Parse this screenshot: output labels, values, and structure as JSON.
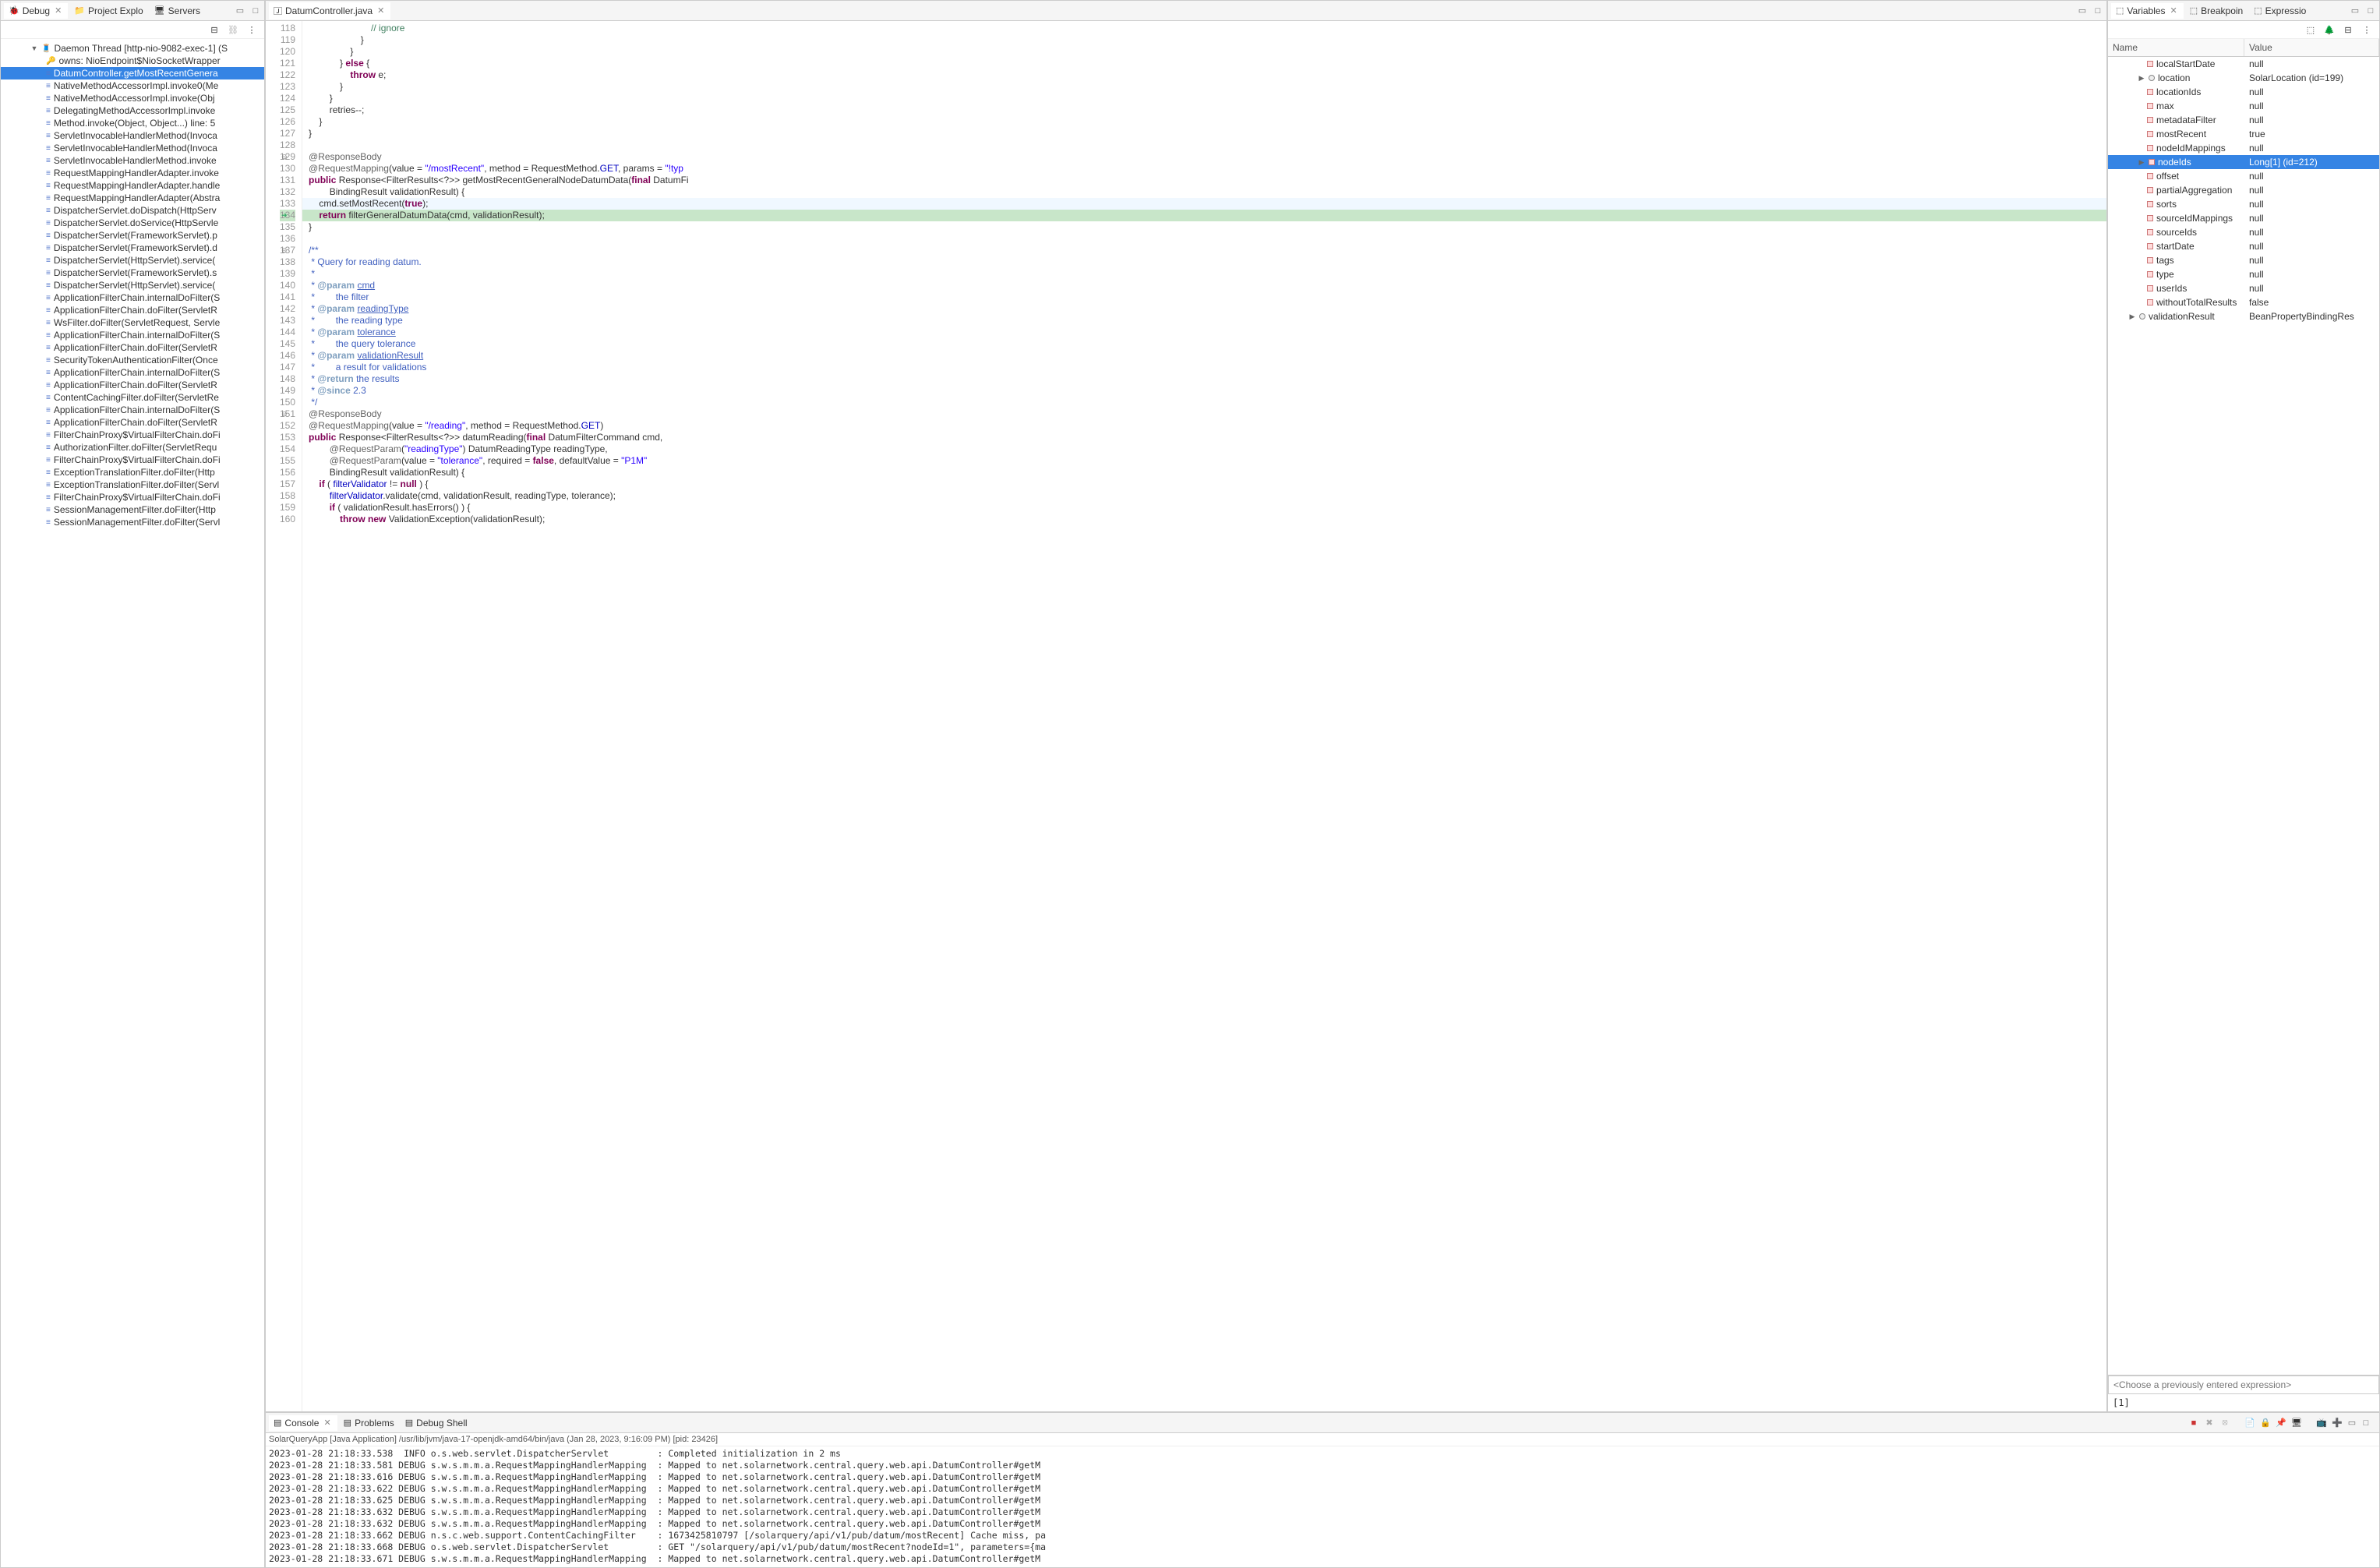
{
  "leftPanel": {
    "tabs": [
      {
        "label": "Debug",
        "icon": "🐞",
        "active": true,
        "close": true
      },
      {
        "label": "Project Explo",
        "icon": "📁"
      },
      {
        "label": "Servers",
        "icon": "🖥"
      }
    ],
    "tree": [
      {
        "indent": 30,
        "chevron": "▼",
        "icon": "🧵",
        "text": "Daemon Thread [http-nio-9082-exec-1] (S"
      },
      {
        "indent": 50,
        "icon": "🔑",
        "text": "owns: NioEndpoint$NioSocketWrapper"
      },
      {
        "indent": 50,
        "icon": "≡",
        "text": "DatumController.getMostRecentGenera",
        "selected": true
      },
      {
        "indent": 50,
        "icon": "≡",
        "text": "NativeMethodAccessorImpl.invoke0(Me"
      },
      {
        "indent": 50,
        "icon": "≡",
        "text": "NativeMethodAccessorImpl.invoke(Obj"
      },
      {
        "indent": 50,
        "icon": "≡",
        "text": "DelegatingMethodAccessorImpl.invoke"
      },
      {
        "indent": 50,
        "icon": "≡",
        "text": "Method.invoke(Object, Object...) line: 5"
      },
      {
        "indent": 50,
        "icon": "≡",
        "text": "ServletInvocableHandlerMethod(Invoca"
      },
      {
        "indent": 50,
        "icon": "≡",
        "text": "ServletInvocableHandlerMethod(Invoca"
      },
      {
        "indent": 50,
        "icon": "≡",
        "text": "ServletInvocableHandlerMethod.invoke"
      },
      {
        "indent": 50,
        "icon": "≡",
        "text": "RequestMappingHandlerAdapter.invoke"
      },
      {
        "indent": 50,
        "icon": "≡",
        "text": "RequestMappingHandlerAdapter.handle"
      },
      {
        "indent": 50,
        "icon": "≡",
        "text": "RequestMappingHandlerAdapter(Abstra"
      },
      {
        "indent": 50,
        "icon": "≡",
        "text": "DispatcherServlet.doDispatch(HttpServ"
      },
      {
        "indent": 50,
        "icon": "≡",
        "text": "DispatcherServlet.doService(HttpServle"
      },
      {
        "indent": 50,
        "icon": "≡",
        "text": "DispatcherServlet(FrameworkServlet).p"
      },
      {
        "indent": 50,
        "icon": "≡",
        "text": "DispatcherServlet(FrameworkServlet).d"
      },
      {
        "indent": 50,
        "icon": "≡",
        "text": "DispatcherServlet(HttpServlet).service("
      },
      {
        "indent": 50,
        "icon": "≡",
        "text": "DispatcherServlet(FrameworkServlet).s"
      },
      {
        "indent": 50,
        "icon": "≡",
        "text": "DispatcherServlet(HttpServlet).service("
      },
      {
        "indent": 50,
        "icon": "≡",
        "text": "ApplicationFilterChain.internalDoFilter(S"
      },
      {
        "indent": 50,
        "icon": "≡",
        "text": "ApplicationFilterChain.doFilter(ServletR"
      },
      {
        "indent": 50,
        "icon": "≡",
        "text": "WsFilter.doFilter(ServletRequest, Servle"
      },
      {
        "indent": 50,
        "icon": "≡",
        "text": "ApplicationFilterChain.internalDoFilter(S"
      },
      {
        "indent": 50,
        "icon": "≡",
        "text": "ApplicationFilterChain.doFilter(ServletR"
      },
      {
        "indent": 50,
        "icon": "≡",
        "text": "SecurityTokenAuthenticationFilter(Once"
      },
      {
        "indent": 50,
        "icon": "≡",
        "text": "ApplicationFilterChain.internalDoFilter(S"
      },
      {
        "indent": 50,
        "icon": "≡",
        "text": "ApplicationFilterChain.doFilter(ServletR"
      },
      {
        "indent": 50,
        "icon": "≡",
        "text": "ContentCachingFilter.doFilter(ServletRe"
      },
      {
        "indent": 50,
        "icon": "≡",
        "text": "ApplicationFilterChain.internalDoFilter(S"
      },
      {
        "indent": 50,
        "icon": "≡",
        "text": "ApplicationFilterChain.doFilter(ServletR"
      },
      {
        "indent": 50,
        "icon": "≡",
        "text": "FilterChainProxy$VirtualFilterChain.doFi"
      },
      {
        "indent": 50,
        "icon": "≡",
        "text": "AuthorizationFilter.doFilter(ServletRequ"
      },
      {
        "indent": 50,
        "icon": "≡",
        "text": "FilterChainProxy$VirtualFilterChain.doFi"
      },
      {
        "indent": 50,
        "icon": "≡",
        "text": "ExceptionTranslationFilter.doFilter(Http"
      },
      {
        "indent": 50,
        "icon": "≡",
        "text": "ExceptionTranslationFilter.doFilter(Servl"
      },
      {
        "indent": 50,
        "icon": "≡",
        "text": "FilterChainProxy$VirtualFilterChain.doFi"
      },
      {
        "indent": 50,
        "icon": "≡",
        "text": "SessionManagementFilter.doFilter(Http"
      },
      {
        "indent": 50,
        "icon": "≡",
        "text": "SessionManagementFilter.doFilter(Servl"
      }
    ]
  },
  "editor": {
    "tab": "DatumController.java",
    "startLine": 118,
    "lines": [
      {
        "n": 118,
        "html": "                        <span class='cm'>// ignore</span>"
      },
      {
        "n": 119,
        "html": "                    }"
      },
      {
        "n": 120,
        "html": "                }"
      },
      {
        "n": 121,
        "html": "            } <span class='kw'>else</span> {"
      },
      {
        "n": 122,
        "html": "                <span class='kw'>throw</span> e;"
      },
      {
        "n": 123,
        "html": "            }"
      },
      {
        "n": 124,
        "html": "        }"
      },
      {
        "n": 125,
        "html": "        retries--;"
      },
      {
        "n": 126,
        "html": "    }"
      },
      {
        "n": 127,
        "html": "}"
      },
      {
        "n": 128,
        "html": ""
      },
      {
        "n": 129,
        "fold": "⊖",
        "html": "<span class='ann'>@ResponseBody</span>"
      },
      {
        "n": 130,
        "html": "<span class='ann'>@RequestMapping</span>(value = <span class='str'>\"/mostRecent\"</span>, method = RequestMethod.<span class='fld'>GET</span>, params = <span class='str'>\"!typ</span>"
      },
      {
        "n": 131,
        "html": "<span class='kw'>public</span> Response&lt;FilterResults&lt;?&gt;&gt; getMostRecentGeneralNodeDatumData(<span class='kw'>final</span> DatumFi"
      },
      {
        "n": 132,
        "html": "        BindingResult validationResult) {"
      },
      {
        "n": 133,
        "execbg": true,
        "html": "    cmd.setMostRecent(<span class='kw'>true</span>);"
      },
      {
        "n": 134,
        "current": true,
        "html": "    <span class='kw'>return</span> filterGeneralDatumData(cmd, validationResult);"
      },
      {
        "n": 135,
        "html": "}"
      },
      {
        "n": 136,
        "html": ""
      },
      {
        "n": 137,
        "fold": "⊖",
        "html": "<span class='jdoc'>/**</span>"
      },
      {
        "n": 138,
        "html": "<span class='jdoc'> * Query for reading datum.</span>"
      },
      {
        "n": 139,
        "html": "<span class='jdoc'> *</span>"
      },
      {
        "n": 140,
        "html": "<span class='jdoc'> * <span class='jdoc-tag'>@param</span> <span class='jdoc-link'>cmd</span></span>"
      },
      {
        "n": 141,
        "html": "<span class='jdoc'> *        the filter</span>"
      },
      {
        "n": 142,
        "html": "<span class='jdoc'> * <span class='jdoc-tag'>@param</span> <span class='jdoc-link'>readingType</span></span>"
      },
      {
        "n": 143,
        "html": "<span class='jdoc'> *        the reading type</span>"
      },
      {
        "n": 144,
        "html": "<span class='jdoc'> * <span class='jdoc-tag'>@param</span> <span class='jdoc-link'>tolerance</span></span>"
      },
      {
        "n": 145,
        "html": "<span class='jdoc'> *        the query tolerance</span>"
      },
      {
        "n": 146,
        "html": "<span class='jdoc'> * <span class='jdoc-tag'>@param</span> <span class='jdoc-link'>validationResult</span></span>"
      },
      {
        "n": 147,
        "html": "<span class='jdoc'> *        a result for validations</span>"
      },
      {
        "n": 148,
        "html": "<span class='jdoc'> * <span class='jdoc-tag'>@return</span> the results</span>"
      },
      {
        "n": 149,
        "html": "<span class='jdoc'> * <span class='jdoc-tag'>@since</span> 2.3</span>"
      },
      {
        "n": 150,
        "html": "<span class='jdoc'> */</span>"
      },
      {
        "n": 151,
        "fold": "⊖",
        "html": "<span class='ann'>@ResponseBody</span>"
      },
      {
        "n": 152,
        "html": "<span class='ann'>@RequestMapping</span>(value = <span class='str'>\"/reading\"</span>, method = RequestMethod.<span class='fld'>GET</span>)"
      },
      {
        "n": 153,
        "html": "<span class='kw'>public</span> Response&lt;FilterResults&lt;?&gt;&gt; datumReading(<span class='kw'>final</span> DatumFilterCommand cmd,"
      },
      {
        "n": 154,
        "html": "        <span class='ann'>@RequestParam</span>(<span class='str'>\"readingType\"</span>) DatumReadingType readingType,"
      },
      {
        "n": 155,
        "html": "        <span class='ann'>@RequestParam</span>(value = <span class='str'>\"tolerance\"</span>, required = <span class='kw'>false</span>, defaultValue = <span class='str'>\"P1M\"</span>"
      },
      {
        "n": 156,
        "html": "        BindingResult validationResult) {"
      },
      {
        "n": 157,
        "html": "    <span class='kw'>if</span> ( <span class='fld'>filterValidator</span> != <span class='kw'>null</span> ) {"
      },
      {
        "n": 158,
        "html": "        <span class='fld'>filterValidator</span>.validate(cmd, validationResult, readingType, tolerance);"
      },
      {
        "n": 159,
        "html": "        <span class='kw'>if</span> ( validationResult.hasErrors() ) {"
      },
      {
        "n": 160,
        "html": "            <span class='kw'>throw new</span> ValidationException(validationResult);"
      }
    ]
  },
  "variables": {
    "tabs": [
      {
        "label": "Variables",
        "active": true,
        "close": true
      },
      {
        "label": "Breakpoin"
      },
      {
        "label": "Expressio"
      }
    ],
    "headers": {
      "name": "Name",
      "value": "Value"
    },
    "rows": [
      {
        "indent": 40,
        "name": "localStartDate",
        "value": "null"
      },
      {
        "indent": 28,
        "chevron": "▶",
        "name": "location",
        "value": "SolarLocation  (id=199)",
        "type": "obj"
      },
      {
        "indent": 40,
        "name": "locationIds",
        "value": "null"
      },
      {
        "indent": 40,
        "name": "max",
        "value": "null"
      },
      {
        "indent": 40,
        "name": "metadataFilter",
        "value": "null"
      },
      {
        "indent": 40,
        "name": "mostRecent",
        "value": "true"
      },
      {
        "indent": 40,
        "name": "nodeIdMappings",
        "value": "null"
      },
      {
        "indent": 28,
        "chevron": "▶",
        "name": "nodeIds",
        "value": "Long[1]  (id=212)",
        "selected": true
      },
      {
        "indent": 40,
        "name": "offset",
        "value": "null"
      },
      {
        "indent": 40,
        "name": "partialAggregation",
        "value": "null"
      },
      {
        "indent": 40,
        "name": "sorts",
        "value": "null"
      },
      {
        "indent": 40,
        "name": "sourceIdMappings",
        "value": "null"
      },
      {
        "indent": 40,
        "name": "sourceIds",
        "value": "null"
      },
      {
        "indent": 40,
        "name": "startDate",
        "value": "null"
      },
      {
        "indent": 40,
        "name": "tags",
        "value": "null"
      },
      {
        "indent": 40,
        "name": "type",
        "value": "null"
      },
      {
        "indent": 40,
        "name": "userIds",
        "value": "null"
      },
      {
        "indent": 40,
        "name": "withoutTotalResults",
        "value": "false"
      },
      {
        "indent": 16,
        "chevron": "▶",
        "name": "validationResult",
        "value": "BeanPropertyBindingRes",
        "type": "obj"
      }
    ],
    "exprPlaceholder": "<Choose a previously entered expression>",
    "exprResult": "[1]"
  },
  "console": {
    "tabs": [
      {
        "label": "Console",
        "active": true,
        "close": true
      },
      {
        "label": "Problems"
      },
      {
        "label": "Debug Shell"
      }
    ],
    "title": "SolarQueryApp [Java Application] /usr/lib/jvm/java-17-openjdk-amd64/bin/java  (Jan 28, 2023, 9:16:09 PM) [pid: 23426]",
    "lines": [
      "2023-01-28 21:18:33.538  INFO o.s.web.servlet.DispatcherServlet         : Completed initialization in 2 ms",
      "2023-01-28 21:18:33.581 DEBUG s.w.s.m.m.a.RequestMappingHandlerMapping  : Mapped to net.solarnetwork.central.query.web.api.DatumController#getM",
      "2023-01-28 21:18:33.616 DEBUG s.w.s.m.m.a.RequestMappingHandlerMapping  : Mapped to net.solarnetwork.central.query.web.api.DatumController#getM",
      "2023-01-28 21:18:33.622 DEBUG s.w.s.m.m.a.RequestMappingHandlerMapping  : Mapped to net.solarnetwork.central.query.web.api.DatumController#getM",
      "2023-01-28 21:18:33.625 DEBUG s.w.s.m.m.a.RequestMappingHandlerMapping  : Mapped to net.solarnetwork.central.query.web.api.DatumController#getM",
      "2023-01-28 21:18:33.632 DEBUG s.w.s.m.m.a.RequestMappingHandlerMapping  : Mapped to net.solarnetwork.central.query.web.api.DatumController#getM",
      "2023-01-28 21:18:33.632 DEBUG s.w.s.m.m.a.RequestMappingHandlerMapping  : Mapped to net.solarnetwork.central.query.web.api.DatumController#getM",
      "2023-01-28 21:18:33.662 DEBUG n.s.c.web.support.ContentCachingFilter    : 1673425810797 [/solarquery/api/v1/pub/datum/mostRecent] Cache miss, pa",
      "2023-01-28 21:18:33.668 DEBUG o.s.web.servlet.DispatcherServlet         : GET \"/solarquery/api/v1/pub/datum/mostRecent?nodeId=1\", parameters={ma",
      "2023-01-28 21:18:33.671 DEBUG s.w.s.m.m.a.RequestMappingHandlerMapping  : Mapped to net.solarnetwork.central.query.web.api.DatumController#getM"
    ]
  }
}
